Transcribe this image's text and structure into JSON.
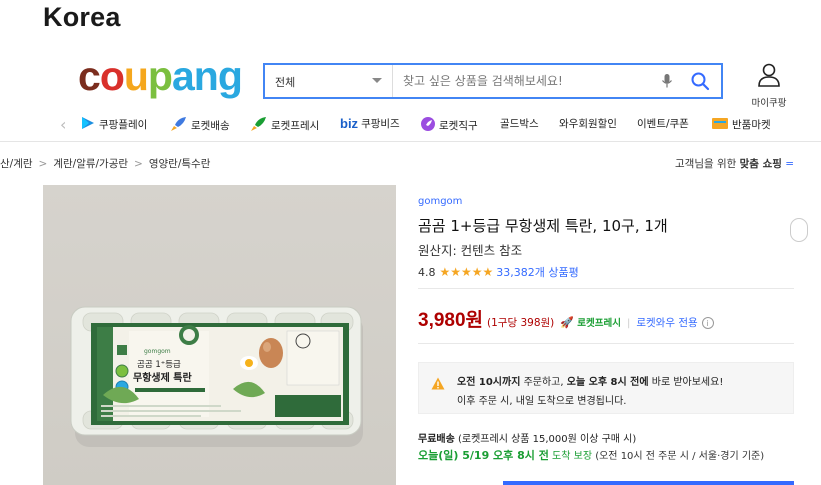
{
  "page": {
    "heading": "Korea"
  },
  "logo": {
    "letters": [
      "c",
      "o",
      "u",
      "p",
      "a",
      "n",
      "g"
    ],
    "colors": [
      "#7b2d1e",
      "#d9302b",
      "#f5a71d",
      "#7bbf3f",
      "#2aa8e0",
      "#2aa8e0",
      "#2aa8e0"
    ]
  },
  "search": {
    "category": "전체",
    "placeholder": "찾고 싶은 상품을 검색해보세요!"
  },
  "account": {
    "label": "마이쿠팡"
  },
  "nav": {
    "items": [
      {
        "label": "쿠팡플레이",
        "icon": "coupang-play-icon"
      },
      {
        "label": "로켓배송",
        "icon": "rocket-icon"
      },
      {
        "label": "로켓프레시",
        "icon": "rocket-fresh-icon"
      },
      {
        "label": "쿠팡비즈",
        "prefix": "biz",
        "icon": "biz-icon"
      },
      {
        "label": "로켓직구",
        "icon": "rocket-direct-icon"
      },
      {
        "label": "골드박스",
        "icon": ""
      },
      {
        "label": "와우회원할인",
        "icon": ""
      },
      {
        "label": "이벤트/쿠폰",
        "icon": ""
      },
      {
        "label": "반품마켓",
        "icon": "return-market-icon"
      }
    ]
  },
  "breadcrumb": {
    "items": [
      "산/계란",
      "계란/알류/가공란",
      "영양란/특수란"
    ],
    "separator": ">"
  },
  "recommend": {
    "text_pre": "고객님을 위한 ",
    "text_bold": "맞춤 쇼핑",
    "text_blue": "="
  },
  "product": {
    "brand": "gomgom",
    "title": "곰곰 1+등급 무항생제 특란, 10구, 1개",
    "origin": "원산지: 컨텐츠 참조",
    "rating": "4.8",
    "stars": "★★★★★",
    "review_count": "33,382개 상품평",
    "price": "3,980원",
    "unit_price": "(1구당 398원)",
    "rocket_fresh": "로켓프레시",
    "wow_only": "로켓와우 전용",
    "info_mark": "i",
    "package_brand": "gomgom",
    "package_grade": "곰곰 1⁺등급",
    "package_name": "무항생제 특란"
  },
  "notice": {
    "line1_bold1": "오전 10시까지",
    "line1_mid": " 주문하고, ",
    "line1_bold2": "오늘 오후 8시 전에",
    "line1_end": " 바로 받아보세요!",
    "line2": "이후 주문 시, 내일 도착으로 변경됩니다."
  },
  "shipping": {
    "free_label": "무료배송",
    "free_detail": " (로켓프레시 상품 15,000원 이상 구매 시)",
    "arrival_date": "오늘(일) 5/19 오후 8시 전",
    "arrival_guarantee": " 도착 보장",
    "arrival_detail": " (오전 10시 전 주문 시 / 서울·경기 기준)"
  },
  "colors": {
    "accent": "#346aff",
    "price": "#ae0000",
    "fresh": "#1a9e33",
    "star": "#f5a623"
  }
}
